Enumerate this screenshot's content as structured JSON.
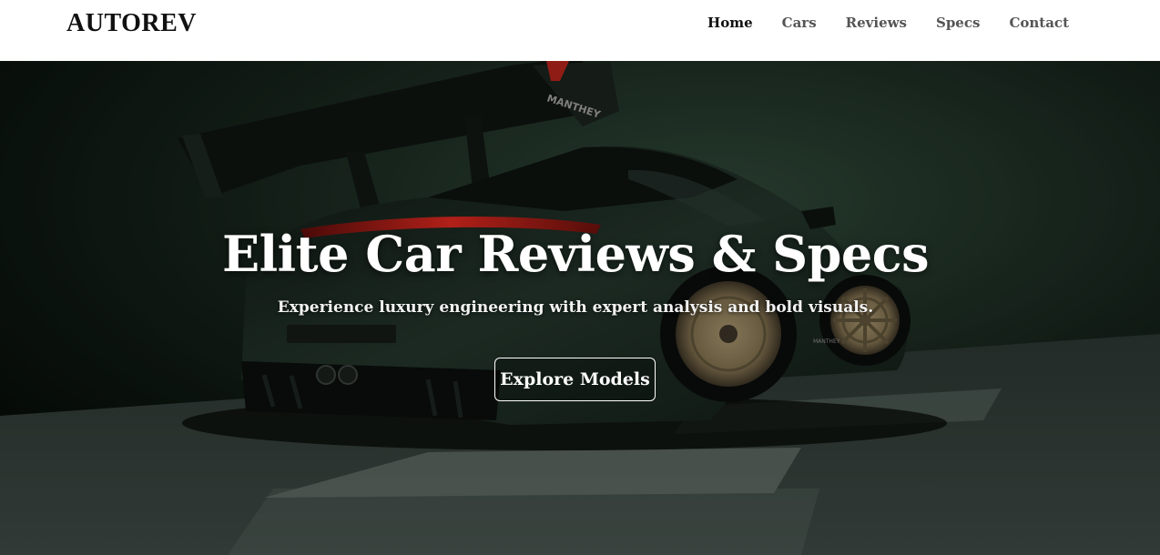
{
  "brand": {
    "logo": "AUTOREV"
  },
  "nav": {
    "items": [
      {
        "label": "Home",
        "active": true
      },
      {
        "label": "Cars",
        "active": false
      },
      {
        "label": "Reviews",
        "active": false
      },
      {
        "label": "Specs",
        "active": false
      },
      {
        "label": "Contact",
        "active": false
      }
    ]
  },
  "hero": {
    "title": "Elite Car Reviews & Specs",
    "subtitle": "Experience luxury engineering with expert analysis and bold visuals.",
    "cta_label": "Explore Models",
    "car_wing_text": "MANTHEY",
    "car_side_badge": "MANTHEY"
  },
  "colors": {
    "nav_bg": "#ffffff",
    "nav_active": "#111111",
    "nav_inactive": "#555555",
    "hero_text": "#ffffff",
    "car_body": "#1d2a22",
    "wheel_gold": "#8a7a5a",
    "tail_light": "#c4211c"
  }
}
